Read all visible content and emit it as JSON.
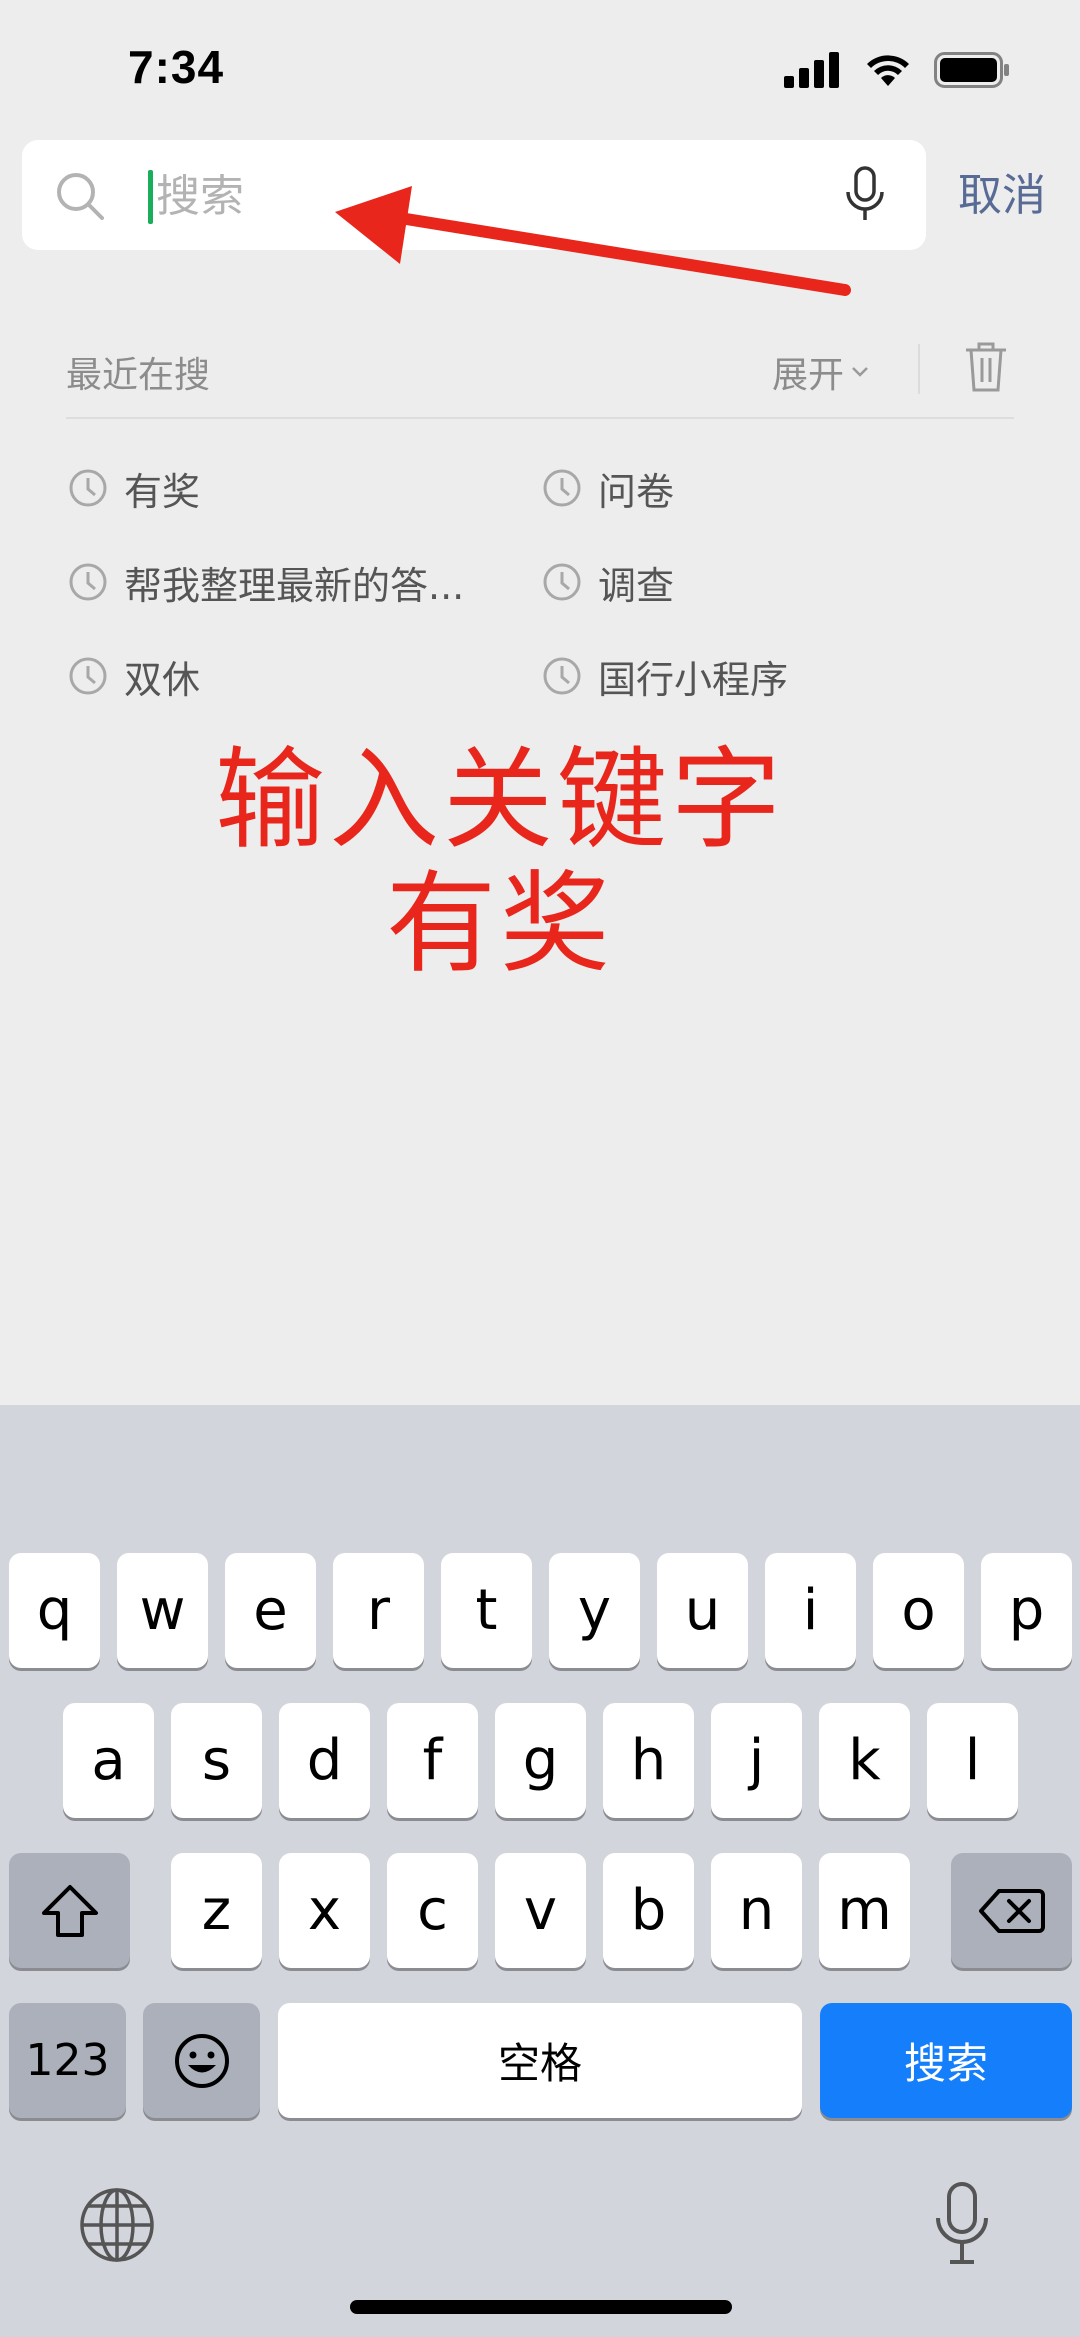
{
  "status_bar": {
    "time": "7:34",
    "icons": [
      "cellular-signal-icon",
      "wifi-icon",
      "battery-icon"
    ]
  },
  "search": {
    "placeholder": "搜索",
    "cancel_label": "取消",
    "icons": [
      "search-icon",
      "voice-input-icon"
    ]
  },
  "recent": {
    "title": "最近在搜",
    "expand_label": "展开",
    "expand_icon": "chevron-down-icon",
    "clear_icon": "trash-icon",
    "items": [
      "有奖",
      "问卷",
      "帮我整理最新的答...",
      "调查",
      "双休",
      "国行小程序"
    ]
  },
  "annotation": {
    "line1": "输入关键字",
    "line2": "有奖",
    "color": "#e8261c"
  },
  "keyboard": {
    "row1": [
      "q",
      "w",
      "e",
      "r",
      "t",
      "y",
      "u",
      "i",
      "o",
      "p"
    ],
    "row2": [
      "a",
      "s",
      "d",
      "f",
      "g",
      "h",
      "j",
      "k",
      "l"
    ],
    "row3": [
      "z",
      "x",
      "c",
      "v",
      "b",
      "n",
      "m"
    ],
    "numbers_label": "123",
    "space_label": "空格",
    "search_label": "搜索",
    "icons": [
      "shift-icon",
      "delete-icon",
      "emoji-icon",
      "globe-icon",
      "dictation-icon"
    ]
  },
  "colors": {
    "background": "#ededed",
    "link": "#576b95",
    "accent_green": "#1aad5b",
    "keyboard_bg": "#d3d5dc",
    "search_key": "#147efb"
  }
}
